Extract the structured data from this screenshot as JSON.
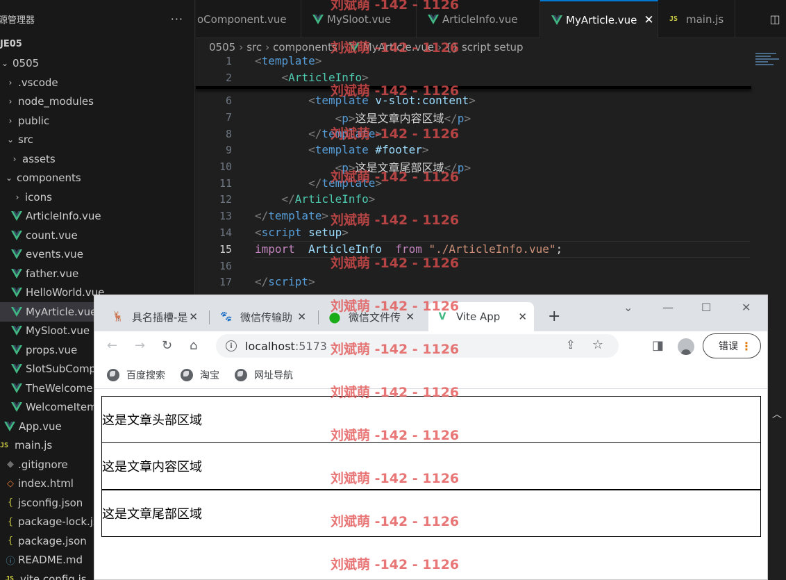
{
  "sidebar": {
    "title": "源管理器",
    "more": "···",
    "items": [
      {
        "label": "JE05",
        "type": "root",
        "chev": "",
        "icon": ""
      },
      {
        "label": "0505",
        "type": "folder",
        "chev": "⌄",
        "icon": ""
      },
      {
        "label": ".vscode",
        "type": "folder",
        "chev": "›",
        "icon": ""
      },
      {
        "label": "node_modules",
        "type": "folder",
        "chev": "›",
        "icon": ""
      },
      {
        "label": "public",
        "type": "folder",
        "chev": "›",
        "icon": ""
      },
      {
        "label": "src",
        "type": "folder",
        "chev": "⌄",
        "icon": ""
      },
      {
        "label": "assets",
        "type": "folder",
        "chev": "›",
        "icon": ""
      },
      {
        "label": "components",
        "type": "folder",
        "chev": "⌄",
        "icon": ""
      },
      {
        "label": "icons",
        "type": "folder",
        "chev": "›",
        "icon": ""
      },
      {
        "label": "ArticleInfo.vue",
        "type": "vue"
      },
      {
        "label": "count.vue",
        "type": "vue"
      },
      {
        "label": "events.vue",
        "type": "vue"
      },
      {
        "label": "father.vue",
        "type": "vue"
      },
      {
        "label": "HelloWorld.vue",
        "type": "vue"
      },
      {
        "label": "MyArticle.vue",
        "type": "vue",
        "selected": true
      },
      {
        "label": "MySloot.vue",
        "type": "vue"
      },
      {
        "label": "props.vue",
        "type": "vue"
      },
      {
        "label": "SlotSubCompo",
        "type": "vue"
      },
      {
        "label": "TheWelcome.vue",
        "type": "vue"
      },
      {
        "label": "WelcomeItem.",
        "type": "vue"
      },
      {
        "label": "App.vue",
        "type": "vue"
      },
      {
        "label": "main.js",
        "type": "js"
      },
      {
        "label": ".gitignore",
        "type": "git"
      },
      {
        "label": "index.html",
        "type": "html"
      },
      {
        "label": "jsconfig.json",
        "type": "json"
      },
      {
        "label": "package-lock.json",
        "type": "json"
      },
      {
        "label": "package.json",
        "type": "json"
      },
      {
        "label": "README.md",
        "type": "md"
      },
      {
        "label": "vite.config.js",
        "type": "js"
      }
    ]
  },
  "editor": {
    "tabs": [
      {
        "label": "oComponent.vue",
        "icon": "none",
        "active": false
      },
      {
        "label": "MySloot.vue",
        "icon": "vue",
        "active": false
      },
      {
        "label": "ArticleInfo.vue",
        "icon": "vue",
        "active": false
      },
      {
        "label": "MyArticle.vue",
        "icon": "vue",
        "active": true,
        "close": "✕"
      },
      {
        "label": "main.js",
        "icon": "js",
        "active": false
      }
    ],
    "breadcrumb": [
      "0505",
      "src",
      "components",
      "MyArticle.vue",
      "{} script setup"
    ],
    "lines": [
      {
        "num": "1",
        "tokens": [
          [
            "t-br",
            "<"
          ],
          [
            "t-tag",
            "template"
          ],
          [
            "t-br",
            ">"
          ]
        ]
      },
      {
        "num": "2",
        "tokens": [
          [
            "t-txt",
            "    "
          ],
          [
            "t-br",
            "<"
          ],
          [
            "t-comp",
            "ArticleInfo"
          ],
          [
            "t-br",
            ">"
          ]
        ]
      },
      {
        "num": "6",
        "tokens": [
          [
            "t-txt",
            "        "
          ],
          [
            "t-br",
            "<"
          ],
          [
            "t-tag",
            "template"
          ],
          [
            "t-txt",
            " "
          ],
          [
            "t-attr",
            "v-slot:content"
          ],
          [
            "t-br",
            ">"
          ]
        ]
      },
      {
        "num": "7",
        "tokens": [
          [
            "t-txt",
            "            "
          ],
          [
            "t-br",
            "<"
          ],
          [
            "t-tag",
            "p"
          ],
          [
            "t-br",
            ">"
          ],
          [
            "t-txt",
            "这是文章内容区域"
          ],
          [
            "t-br",
            "</"
          ],
          [
            "t-tag",
            "p"
          ],
          [
            "t-br",
            ">"
          ]
        ]
      },
      {
        "num": "8",
        "tokens": [
          [
            "t-txt",
            "        "
          ],
          [
            "t-br",
            "</"
          ],
          [
            "t-tag",
            "template"
          ],
          [
            "t-br",
            ">"
          ]
        ]
      },
      {
        "num": "9",
        "tokens": [
          [
            "t-txt",
            "        "
          ],
          [
            "t-br",
            "<"
          ],
          [
            "t-tag",
            "template"
          ],
          [
            "t-txt",
            " "
          ],
          [
            "t-attr",
            "#footer"
          ],
          [
            "t-br",
            ">"
          ]
        ]
      },
      {
        "num": "10",
        "tokens": [
          [
            "t-txt",
            "            "
          ],
          [
            "t-br",
            "<"
          ],
          [
            "t-tag",
            "p"
          ],
          [
            "t-br",
            ">"
          ],
          [
            "t-txt",
            "这是文章尾部区域"
          ],
          [
            "t-br",
            "</"
          ],
          [
            "t-tag",
            "p"
          ],
          [
            "t-br",
            ">"
          ]
        ]
      },
      {
        "num": "11",
        "tokens": [
          [
            "t-txt",
            "        "
          ],
          [
            "t-br",
            "</"
          ],
          [
            "t-tag",
            "template"
          ],
          [
            "t-br",
            ">"
          ]
        ]
      },
      {
        "num": "12",
        "tokens": [
          [
            "t-txt",
            "    "
          ],
          [
            "t-br",
            "</"
          ],
          [
            "t-comp",
            "ArticleInfo"
          ],
          [
            "t-br",
            ">"
          ]
        ]
      },
      {
        "num": "13",
        "tokens": [
          [
            "t-br",
            "</"
          ],
          [
            "t-tag",
            "template"
          ],
          [
            "t-br",
            ">"
          ]
        ]
      },
      {
        "num": "14",
        "tokens": [
          [
            "t-br",
            "<"
          ],
          [
            "t-tag",
            "script"
          ],
          [
            "t-txt",
            " "
          ],
          [
            "t-attr",
            "setup"
          ],
          [
            "t-br",
            ">"
          ]
        ]
      },
      {
        "num": "15",
        "current": true,
        "tokens": [
          [
            "t-kw",
            "import"
          ],
          [
            "t-txt",
            "  "
          ],
          [
            "t-attr",
            "ArticleInfo"
          ],
          [
            "t-txt",
            "  "
          ],
          [
            "t-kw",
            "from"
          ],
          [
            "t-txt",
            " "
          ],
          [
            "t-str",
            "\"./ArticleInfo.vue\""
          ],
          [
            "t-punc",
            ";"
          ]
        ]
      },
      {
        "num": "16",
        "tokens": []
      },
      {
        "num": "17",
        "tokens": [
          [
            "t-br",
            "</"
          ],
          [
            "t-tag",
            "script"
          ],
          [
            "t-br",
            ">"
          ]
        ]
      }
    ]
  },
  "browser": {
    "tabs": [
      {
        "label": "具名插槽-是",
        "fav": "🦌"
      },
      {
        "label": "微信传输助",
        "fav": "🐾"
      },
      {
        "label": "微信文件传",
        "fav": "●"
      },
      {
        "label": "Vite App",
        "fav": "V",
        "active": true
      }
    ],
    "tab_close": "✕",
    "new_tab": "+",
    "window_controls": {
      "dropdown": "⌄",
      "minimize": "—",
      "maximize": "☐",
      "close": "✕"
    },
    "url_host": "localhost",
    "url_port": ":5173",
    "error_label": "错误",
    "bookmarks": [
      "百度搜索",
      "淘宝",
      "网址导航"
    ],
    "page": {
      "boxes": [
        "这是文章头部区域",
        "这是文章内容区域",
        "这是文章尾部区域"
      ]
    }
  },
  "watermark": "刘斌萌 -142 - 1126",
  "colors": {
    "vue_green": "#41b883",
    "accent": "#0078d4",
    "watermark": "#e25050"
  }
}
